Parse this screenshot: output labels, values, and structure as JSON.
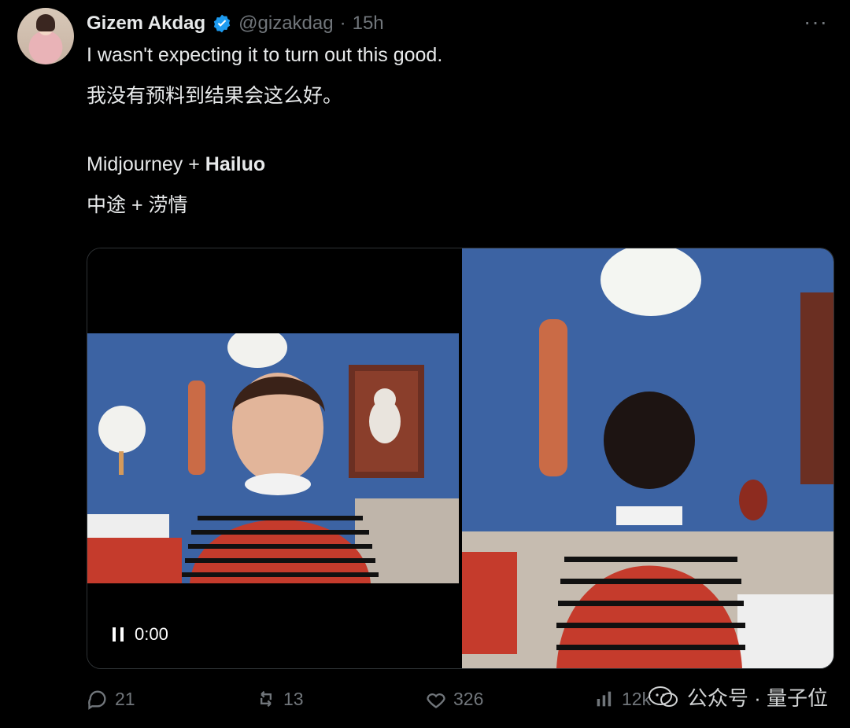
{
  "author": {
    "display_name": "Gizem Akdag",
    "handle": "@gizakdag",
    "separator": "·",
    "time": "15h"
  },
  "more_label": "···",
  "tweet": {
    "line1": "I wasn't expecting it to turn out this good.",
    "line1_zh": "我没有预料到结果会这么好。",
    "line2_prefix": "Midjourney + ",
    "line2_bold": "Hailuo",
    "line2_zh": "中途 + 涝情"
  },
  "video": {
    "time": "0:00"
  },
  "actions": {
    "replies": "21",
    "retweets": "13",
    "likes": "326",
    "views": "12k"
  },
  "watermark": {
    "text": "公众号 · 量子位"
  },
  "colors": {
    "background": "#000000",
    "text": "#e7e9ea",
    "muted": "#71767b",
    "verified": "#1d9bf0",
    "wall_blue": "#3c63a3",
    "sweater_red": "#c53b2c"
  }
}
